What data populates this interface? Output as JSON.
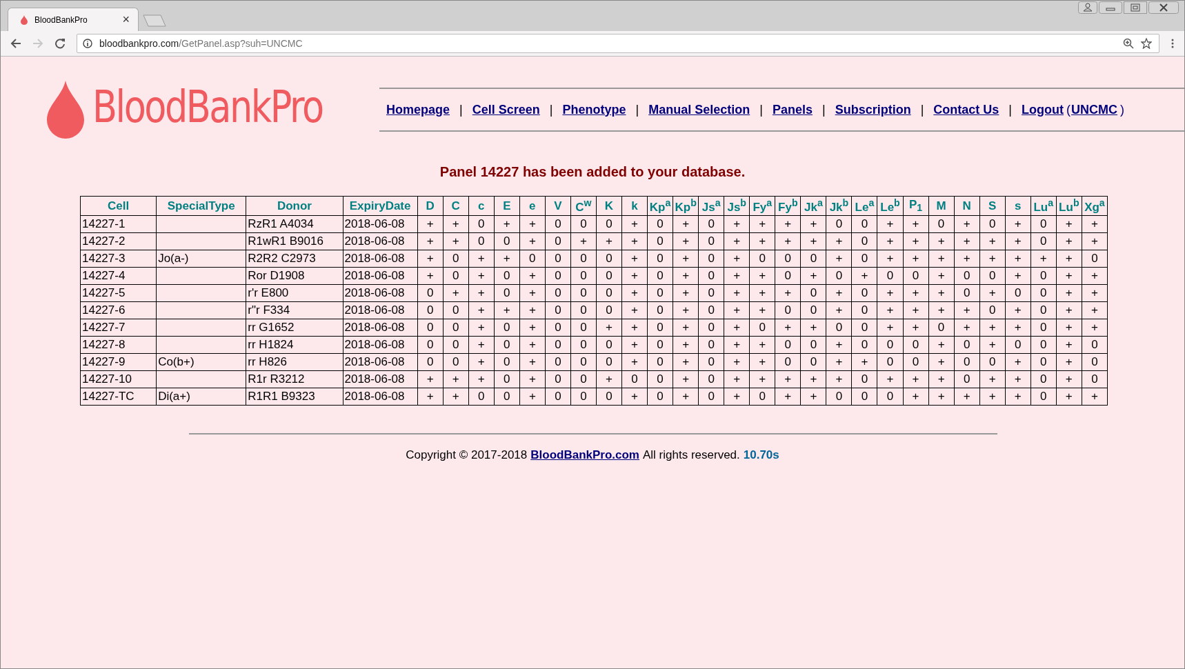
{
  "browser": {
    "tab": {
      "title": "BloodBankPro",
      "close": "×",
      "selected": true
    },
    "address": {
      "host": "bloodbankpro.com",
      "path": "/GetPanel.asp?suh=UNCMC"
    },
    "forward_disabled": true
  },
  "logo": {
    "text": "BloodBankPro"
  },
  "nav": {
    "links": [
      {
        "label": "Homepage",
        "sep": "|"
      },
      {
        "label": "Cell Screen",
        "sep": "|"
      },
      {
        "label": "Phenotype",
        "sep": "|"
      },
      {
        "label": "Manual Selection",
        "sep": "|"
      },
      {
        "label": "Panels",
        "sep": "|"
      },
      {
        "label": "Subscription",
        "sep": "|"
      },
      {
        "label": "Contact Us",
        "sep": "|"
      },
      {
        "label": "Logout"
      }
    ],
    "user": {
      "open": "(",
      "name": "UNCMC",
      "close": ")"
    }
  },
  "message": "Panel 14227 has been added to your database.",
  "table": {
    "columns": [
      "Cell",
      "SpecialType",
      "Donor",
      "ExpiryDate",
      "D",
      "C",
      "c",
      "E",
      "e",
      "V",
      "C$^{w}$",
      "K",
      "k",
      "Kp$^{a}$",
      "Kp$^{b}$",
      "Js$^{a}$",
      "Js$^{b}$",
      "Fy$^{a}$",
      "Fy$^{b}$",
      "Jk$^{a}$",
      "Jk$^{b}$",
      "Le$^{a}$",
      "Le$^{b}$",
      "P$_{1}$",
      "M",
      "N",
      "S",
      "s",
      "Lu$^{a}$",
      "Lu$^{b}$",
      "Xg$^{a}$"
    ],
    "rows": [
      {
        "cell": "14227-1",
        "special_type": "",
        "donor": "RzR1 A4034",
        "expiry": "2018-06-08",
        "antigens": [
          "+",
          "+",
          "0",
          "+",
          "+",
          "0",
          "0",
          "0",
          "+",
          "0",
          "+",
          "0",
          "+",
          "+",
          "+",
          "+",
          "0",
          "0",
          "+",
          "+",
          "0",
          "+",
          "0",
          "+",
          "0",
          "+",
          "+"
        ]
      },
      {
        "cell": "14227-2",
        "special_type": "",
        "donor": "R1wR1 B9016",
        "expiry": "2018-06-08",
        "antigens": [
          "+",
          "+",
          "0",
          "0",
          "+",
          "0",
          "+",
          "+",
          "+",
          "0",
          "+",
          "0",
          "+",
          "+",
          "+",
          "+",
          "+",
          "0",
          "+",
          "+",
          "+",
          "+",
          "+",
          "+",
          "0",
          "+",
          "+"
        ]
      },
      {
        "cell": "14227-3",
        "special_type": "Jo(a-)",
        "donor": "R2R2 C2973",
        "expiry": "2018-06-08",
        "antigens": [
          "+",
          "0",
          "+",
          "+",
          "0",
          "0",
          "0",
          "0",
          "+",
          "0",
          "+",
          "0",
          "+",
          "0",
          "0",
          "0",
          "+",
          "0",
          "+",
          "+",
          "+",
          "+",
          "+",
          "+",
          "+",
          "+",
          "0"
        ]
      },
      {
        "cell": "14227-4",
        "special_type": "",
        "donor": "Ror D1908",
        "expiry": "2018-06-08",
        "antigens": [
          "+",
          "0",
          "+",
          "0",
          "+",
          "0",
          "0",
          "0",
          "+",
          "0",
          "+",
          "0",
          "+",
          "+",
          "0",
          "+",
          "0",
          "+",
          "0",
          "0",
          "+",
          "0",
          "0",
          "+",
          "0",
          "+",
          "+"
        ]
      },
      {
        "cell": "14227-5",
        "special_type": "",
        "donor": "r'r E800",
        "expiry": "2018-06-08",
        "antigens": [
          "0",
          "+",
          "+",
          "0",
          "+",
          "0",
          "0",
          "0",
          "+",
          "0",
          "+",
          "0",
          "+",
          "+",
          "+",
          "0",
          "+",
          "0",
          "+",
          "+",
          "+",
          "0",
          "+",
          "0",
          "0",
          "+",
          "+"
        ]
      },
      {
        "cell": "14227-6",
        "special_type": "",
        "donor": "r\"r F334",
        "expiry": "2018-06-08",
        "antigens": [
          "0",
          "0",
          "+",
          "+",
          "+",
          "0",
          "0",
          "0",
          "+",
          "0",
          "+",
          "0",
          "+",
          "+",
          "0",
          "0",
          "+",
          "0",
          "+",
          "+",
          "+",
          "+",
          "0",
          "+",
          "0",
          "+",
          "+"
        ]
      },
      {
        "cell": "14227-7",
        "special_type": "",
        "donor": "rr G1652",
        "expiry": "2018-06-08",
        "antigens": [
          "0",
          "0",
          "+",
          "0",
          "+",
          "0",
          "0",
          "+",
          "+",
          "0",
          "+",
          "0",
          "+",
          "0",
          "+",
          "+",
          "0",
          "0",
          "+",
          "+",
          "0",
          "+",
          "+",
          "+",
          "0",
          "+",
          "+"
        ]
      },
      {
        "cell": "14227-8",
        "special_type": "",
        "donor": "rr H1824",
        "expiry": "2018-06-08",
        "antigens": [
          "0",
          "0",
          "+",
          "0",
          "+",
          "0",
          "0",
          "0",
          "+",
          "0",
          "+",
          "0",
          "+",
          "+",
          "0",
          "0",
          "+",
          "0",
          "0",
          "0",
          "+",
          "0",
          "+",
          "0",
          "0",
          "+",
          "0"
        ]
      },
      {
        "cell": "14227-9",
        "special_type": "Co(b+)",
        "donor": "rr H826",
        "expiry": "2018-06-08",
        "antigens": [
          "0",
          "0",
          "+",
          "0",
          "+",
          "0",
          "0",
          "0",
          "+",
          "0",
          "+",
          "0",
          "+",
          "+",
          "0",
          "0",
          "+",
          "+",
          "0",
          "0",
          "+",
          "0",
          "0",
          "+",
          "0",
          "+",
          "0"
        ]
      },
      {
        "cell": "14227-10",
        "special_type": "",
        "donor": "R1r R3212",
        "expiry": "2018-06-08",
        "antigens": [
          "+",
          "+",
          "+",
          "0",
          "+",
          "0",
          "0",
          "+",
          "0",
          "0",
          "+",
          "0",
          "+",
          "+",
          "+",
          "+",
          "+",
          "0",
          "+",
          "+",
          "+",
          "0",
          "+",
          "+",
          "0",
          "+",
          "0"
        ]
      },
      {
        "cell": "14227-TC",
        "special_type": "Di(a+)",
        "donor": "R1R1 B9323",
        "expiry": "2018-06-08",
        "antigens": [
          "+",
          "+",
          "0",
          "0",
          "+",
          "0",
          "0",
          "0",
          "+",
          "0",
          "+",
          "0",
          "+",
          "0",
          "+",
          "+",
          "0",
          "0",
          "0",
          "+",
          "+",
          "+",
          "+",
          "+",
          "0",
          "+",
          "+"
        ]
      }
    ]
  },
  "footer": {
    "copyright": "Copyright © 2017-2018",
    "link": "BloodBankPro.com",
    "rights": "All rights reserved.",
    "time": "10.70s"
  }
}
